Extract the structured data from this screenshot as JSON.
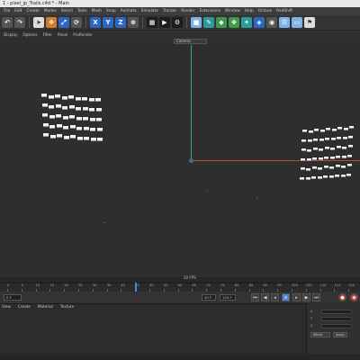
{
  "window": {
    "title": "1 - pixel_jp_Trails.c4d * - Main"
  },
  "menu": [
    "File",
    "Edit",
    "Create",
    "Modes",
    "Select",
    "Tools",
    "Mesh",
    "Snap",
    "Animate",
    "Simulate",
    "Tracker",
    "Render",
    "Extensions",
    "Window",
    "Help",
    "Octane",
    "RedShift"
  ],
  "toolbar": {
    "icons": [
      "undo-icon",
      "redo-icon",
      "select-icon",
      "move-icon",
      "scale-icon",
      "rotate-icon",
      "x-axis-icon",
      "y-axis-icon",
      "z-axis-icon",
      "world-coord-icon",
      "render-view-icon",
      "render-icon",
      "render-settings-icon",
      "cube-icon",
      "pen-icon",
      "subdivide-icon",
      "array-icon",
      "mograph-icon",
      "deformer-icon",
      "camera-icon",
      "light-icon",
      "floor-icon",
      "tag-icon"
    ],
    "axis_labels": [
      "X",
      "Y",
      "Z"
    ]
  },
  "view_menu": [
    "Display",
    "Options",
    "Filter",
    "Panel",
    "ProRender"
  ],
  "camera_select": "Camera",
  "viewport": {
    "fps_label": "20 FPS"
  },
  "timeline": {
    "ticks": [
      "0",
      "5",
      "10",
      "15",
      "20",
      "25",
      "30",
      "35",
      "40",
      "45",
      "50",
      "55",
      "60",
      "65",
      "70",
      "75",
      "80",
      "85",
      "90",
      "95",
      "100",
      "105",
      "110",
      "115",
      "120"
    ],
    "current_frame": "20 F",
    "start_frame": "0 F",
    "end_frame": "120 F"
  },
  "bottom_panel": {
    "menu": [
      "View",
      "Create",
      "Material",
      "Texture"
    ]
  },
  "attributes": {
    "rows": [
      "X",
      "Y",
      "Z"
    ],
    "apply_label": "Apply",
    "mode_label": "World"
  }
}
